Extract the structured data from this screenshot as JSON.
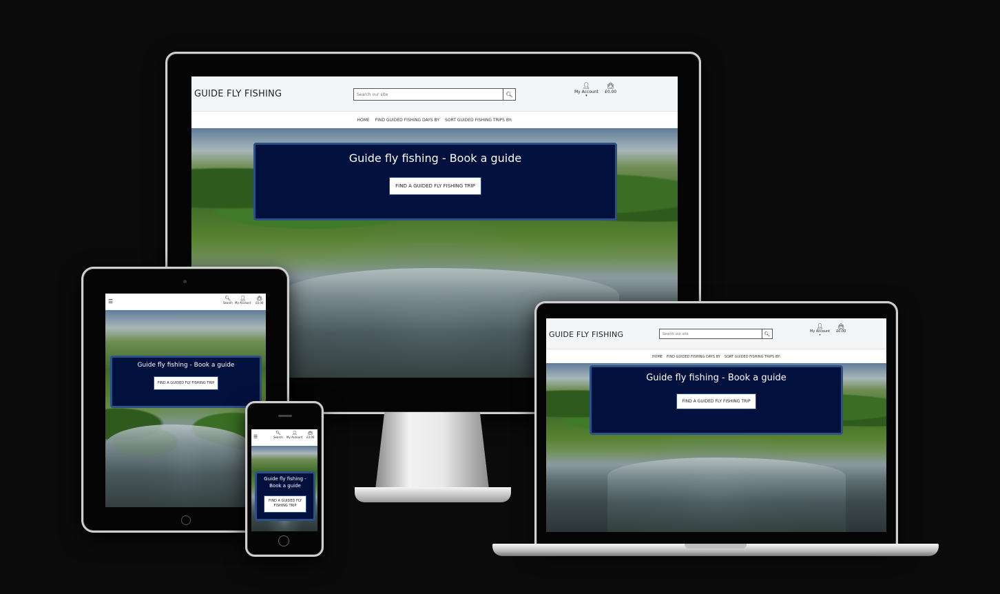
{
  "brand": {
    "name": "GUIDE FLY FISHING",
    "accent_color": "#02103e",
    "border_color": "#2b5288"
  },
  "header": {
    "search_placeholder": "Search our site",
    "search_label": "Search",
    "account_label": "My Account",
    "cart_total": "£0.00"
  },
  "nav": {
    "items": [
      "HOME",
      "FIND GUIDED FISHING DAYS BY",
      "SORT GUIDED FISHING TRIPS BY:"
    ]
  },
  "hero": {
    "title": "Guide fly fishing - Book a guide",
    "cta_label": "FIND A GUIDED FLY FISHING TRIP"
  },
  "mobile_hero": {
    "title_line1": "Guide fly fishing -",
    "title_line2": "Book a guide",
    "cta_line1": "FIND A GUIDED FLY",
    "cta_line2": "FISHING TRIP"
  },
  "icons": {
    "search": "search-icon",
    "account": "user-icon",
    "cart": "shopping-bag-icon",
    "menu": "hamburger-menu-icon"
  }
}
